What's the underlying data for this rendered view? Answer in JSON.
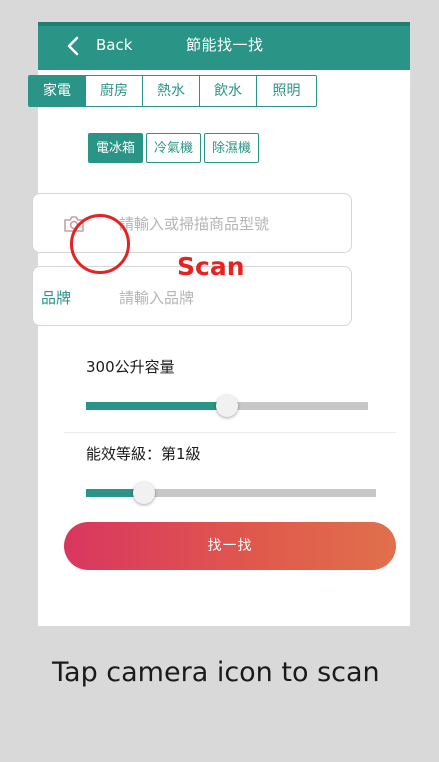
{
  "header": {
    "back_label": "Back",
    "title": "節能找一找"
  },
  "category_tabs": [
    {
      "label": "家電",
      "active": true
    },
    {
      "label": "廚房",
      "active": false
    },
    {
      "label": "熱水",
      "active": false
    },
    {
      "label": "飲水",
      "active": false
    },
    {
      "label": "照明",
      "active": false
    }
  ],
  "appliance_tabs": [
    {
      "label": "電冰箱",
      "active": true
    },
    {
      "label": "冷氣機",
      "active": false
    },
    {
      "label": "除濕機",
      "active": false
    }
  ],
  "model_field": {
    "placeholder": "請輸入或掃描商品型號",
    "icon": "camera-icon"
  },
  "brand_field": {
    "label": "品牌",
    "placeholder": "請輸入品牌"
  },
  "capacity": {
    "label": "300公升容量",
    "slider_fraction": 0.5
  },
  "efficiency": {
    "label": "能效等級：第1級",
    "slider_fraction": 0.2
  },
  "search_button": {
    "label": "找一找"
  },
  "annotation": {
    "scan_label": "Scan",
    "caption": "Tap camera icon to scan"
  },
  "colors": {
    "accent": "#2a9486",
    "annotation": "#e52323",
    "button_start": "#d9365f",
    "button_end": "#e0704b"
  }
}
